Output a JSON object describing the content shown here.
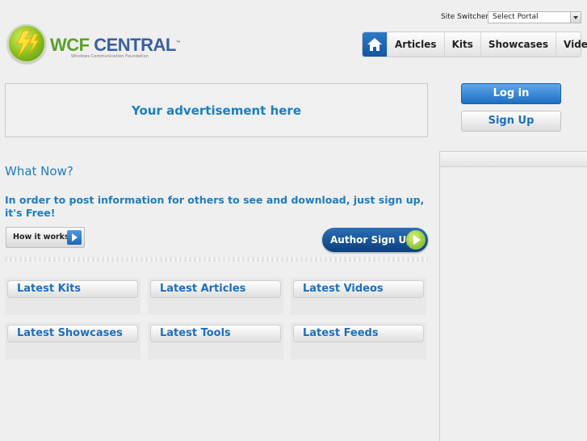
{
  "header": {
    "switcher_label": "Site Switcher:",
    "switcher_value": "Select Portal",
    "logo_main": "WCF ",
    "logo_accent": "CENTRAL",
    "logo_tm": "™",
    "logo_sub": "Windows Communication Foundation"
  },
  "nav": {
    "items": [
      "Articles",
      "Kits",
      "Showcases",
      "Videos"
    ]
  },
  "ad": {
    "text": "Your advertisement here"
  },
  "auth": {
    "login": "Log in",
    "signup": "Sign Up"
  },
  "main": {
    "heading": "What Now?",
    "intro": "In order to post information for others to see and download, just sign up, it's Free!",
    "how_label": "How it works",
    "author_label": "Author Sign Up"
  },
  "tiles": [
    "Latest Kits",
    "Latest Articles",
    "Latest Videos",
    "Latest Showcases",
    "Latest Tools",
    "Latest Feeds"
  ],
  "colors": {
    "accent_blue": "#1b7ec2",
    "brand_green": "#5aa02c",
    "nav_home": "#13569f"
  }
}
